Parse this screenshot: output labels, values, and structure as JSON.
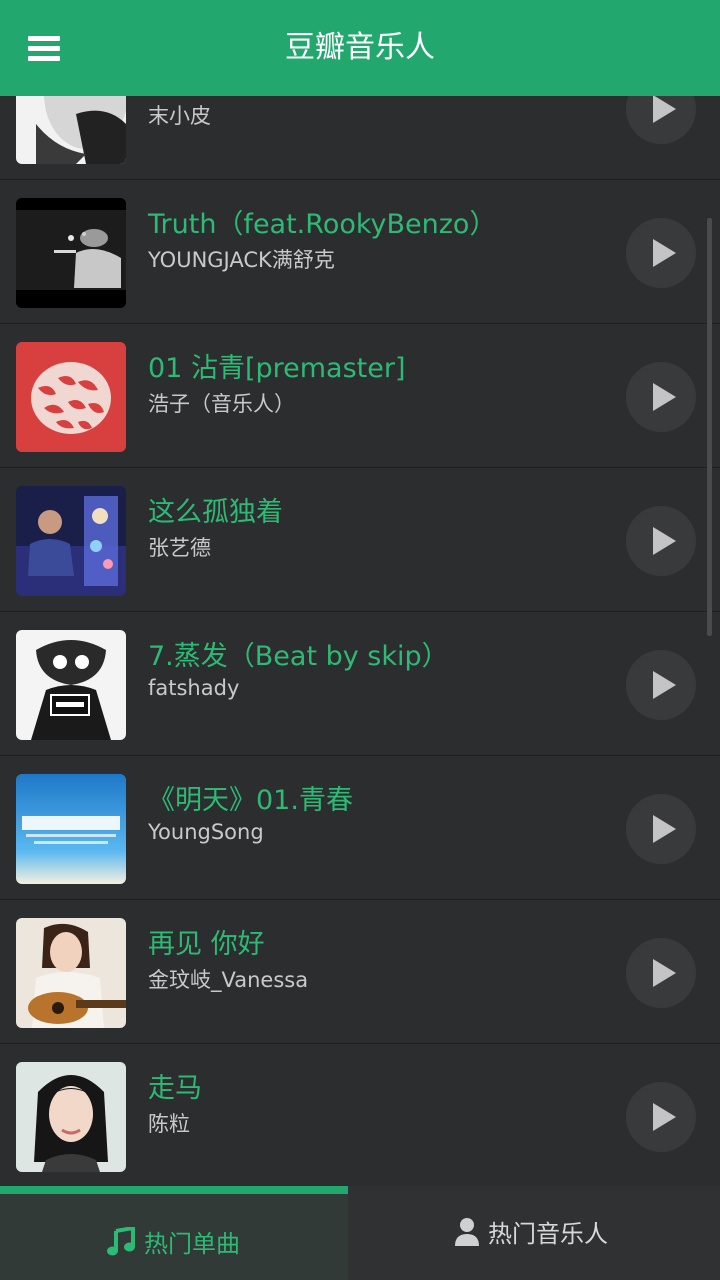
{
  "app_bar": {
    "title": "豆瓣音乐人",
    "menu_icon": "hamburger-menu-icon",
    "background": "#22a86e"
  },
  "songs": [
    {
      "title": "",
      "artist": "末小皮"
    },
    {
      "title": "Truth（feat.RookyBenzo）",
      "artist": "YOUNGJACK满舒克"
    },
    {
      "title": "01 沾青[premaster]",
      "artist": "浩子（音乐人）"
    },
    {
      "title": "这么孤独着",
      "artist": "张艺德"
    },
    {
      "title": "7.蒸发（Beat by skip）",
      "artist": "fatshady"
    },
    {
      "title": "《明天》01.青春",
      "artist": "YoungSong"
    },
    {
      "title": "再见 你好",
      "artist": "金玟岐_Vanessa"
    },
    {
      "title": "走马",
      "artist": "陈粒"
    }
  ],
  "row_play_icon": "play-icon",
  "tabs": [
    {
      "label": "热门单曲",
      "icon": "music-note-icon",
      "active": true
    },
    {
      "label": "热门音乐人",
      "icon": "person-icon",
      "active": false
    }
  ],
  "colors": {
    "accent": "#22a86e",
    "song_title": "#2dba74",
    "background": "#2c2d2f"
  }
}
